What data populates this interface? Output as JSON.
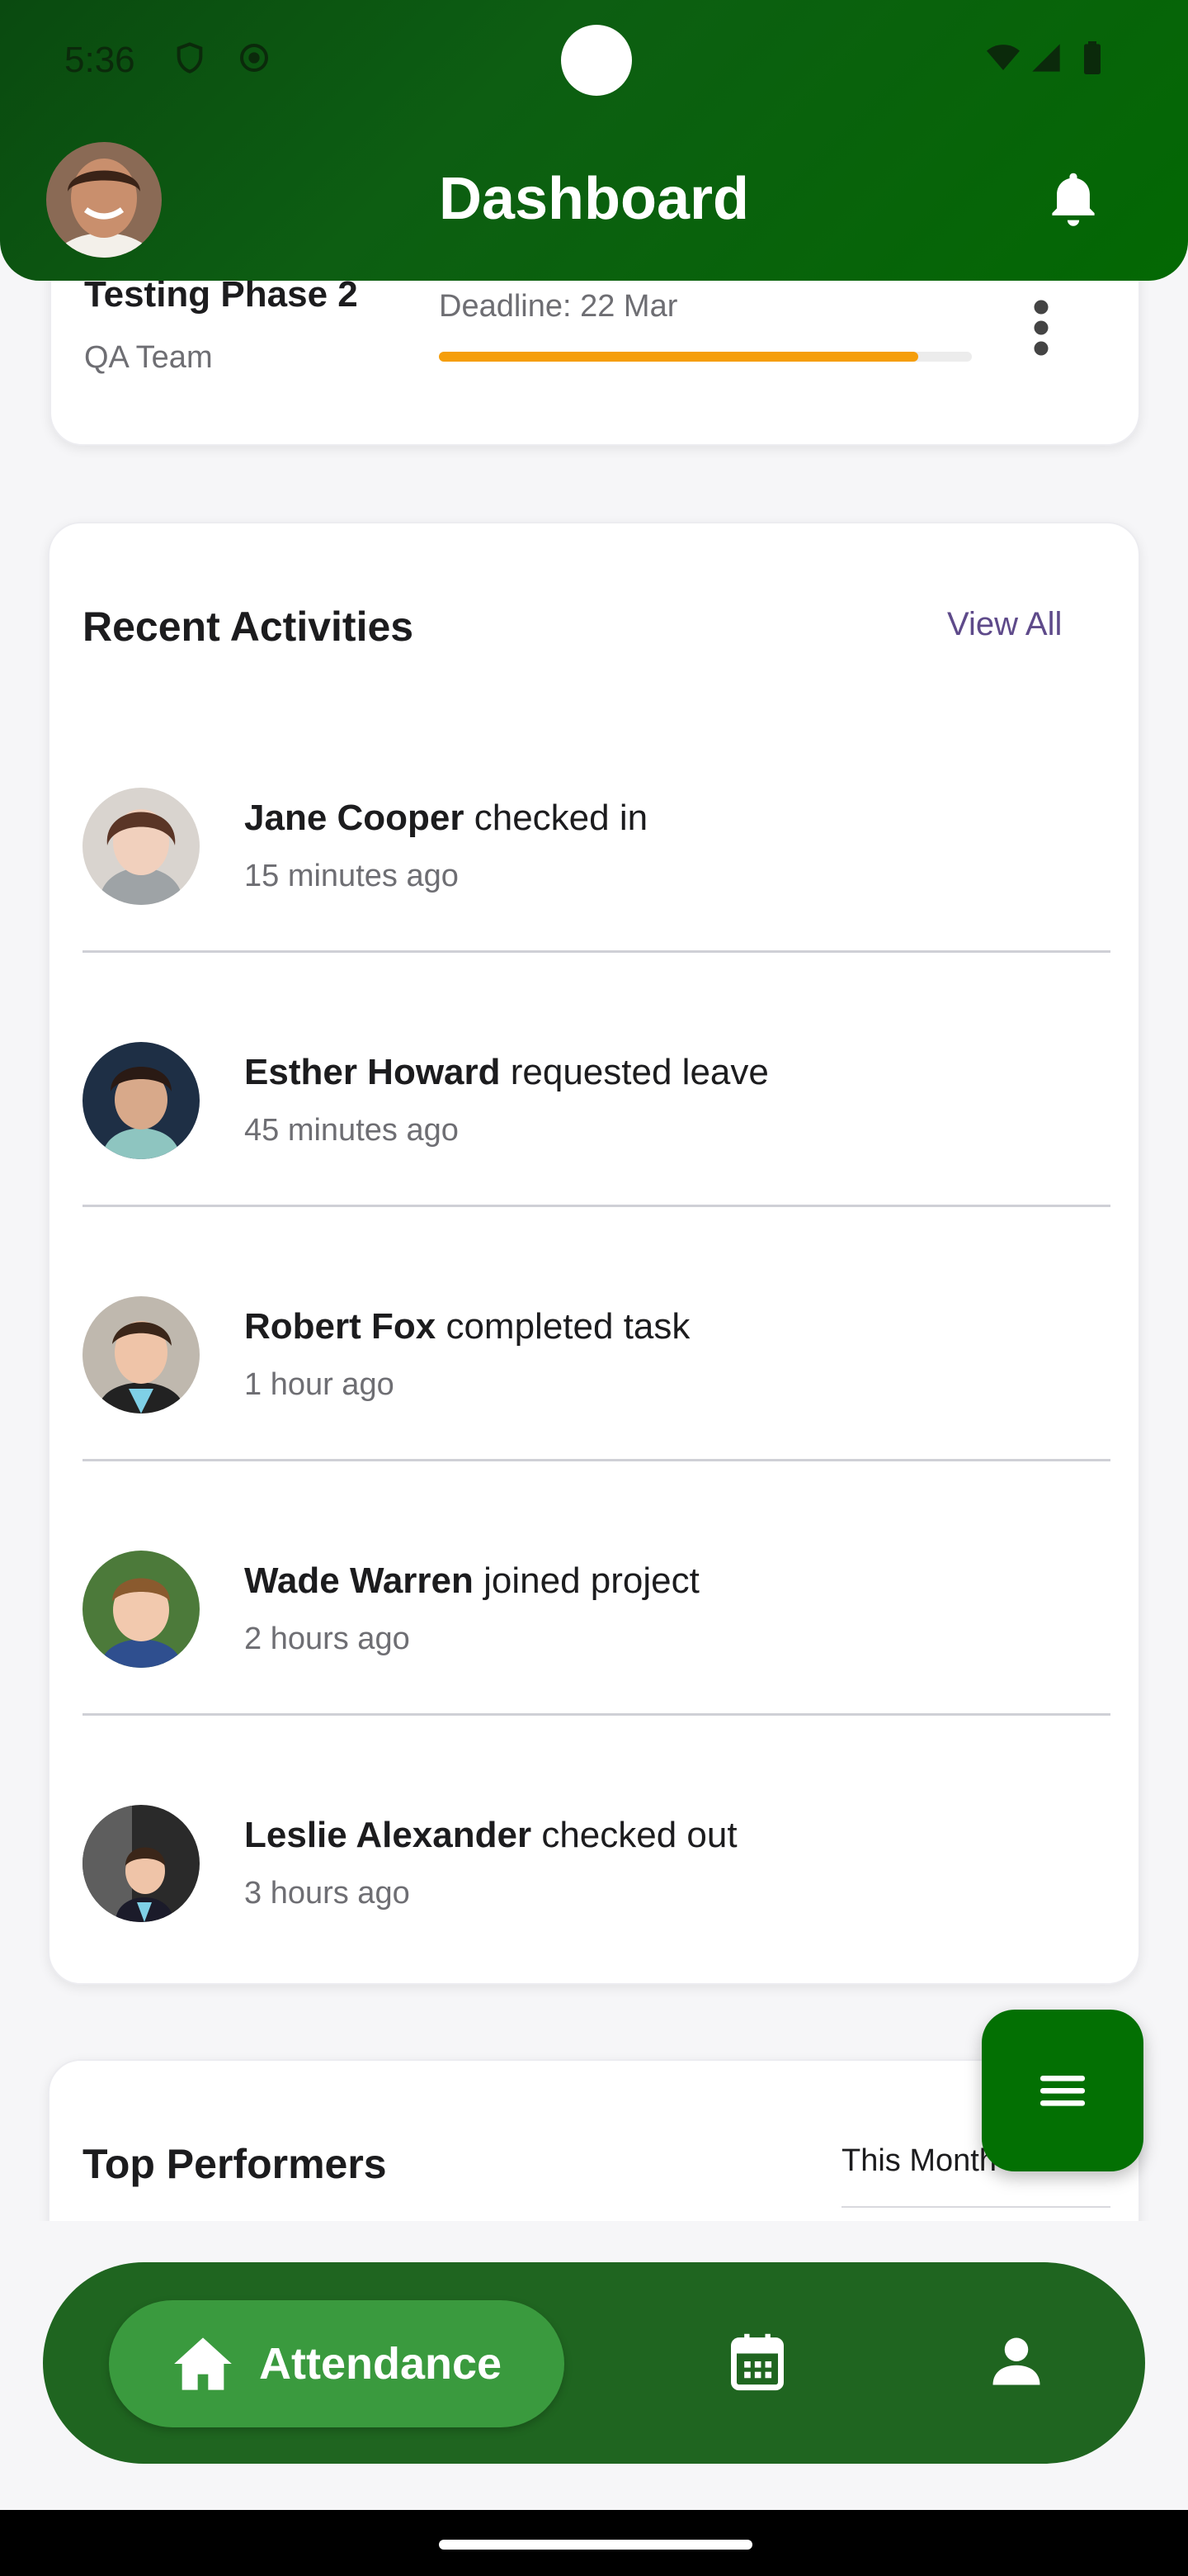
{
  "status_bar": {
    "time": "5:36"
  },
  "header": {
    "title": "Dashboard"
  },
  "project": {
    "name": "Testing Phase 2",
    "team": "QA Team",
    "deadline": "Deadline: 22 Mar",
    "progress": 0.9
  },
  "activities": {
    "title": "Recent Activities",
    "view_all": "View All",
    "items": [
      {
        "name": "Jane Cooper",
        "action": " checked in",
        "time": "15 minutes ago"
      },
      {
        "name": "Esther Howard",
        "action": " requested leave",
        "time": "45 minutes ago"
      },
      {
        "name": "Robert Fox",
        "action": " completed task",
        "time": "1 hour ago"
      },
      {
        "name": "Wade Warren",
        "action": " joined project",
        "time": "2 hours ago"
      },
      {
        "name": "Leslie Alexander",
        "action": " checked out",
        "time": "3 hours ago"
      }
    ]
  },
  "performers": {
    "title": "Top Performers",
    "period": "This Month"
  },
  "bottom_nav": {
    "active_label": "Attendance"
  },
  "colors": {
    "brand_green": "#0d5e12",
    "progress": "#f59e0b",
    "link": "#5e4a8a"
  }
}
